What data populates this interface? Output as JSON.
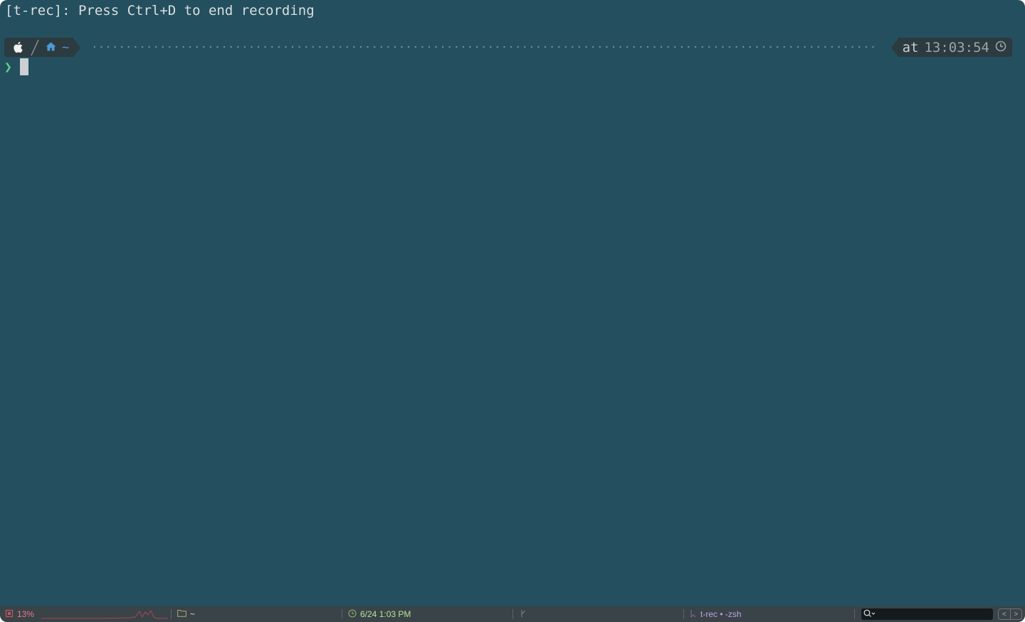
{
  "terminal": {
    "banner": "[t-rec]: Press Ctrl+D to end recording",
    "prompt": {
      "os_icon": "apple-icon",
      "dir_icon": "home-icon",
      "dir": "~",
      "at_label": "at",
      "time": "13:03:54",
      "time_icon": "clock-icon",
      "prompt_char": "❯"
    }
  },
  "statusbar": {
    "cpu": {
      "icon": "cpu-icon",
      "value": "13%"
    },
    "directory": {
      "icon": "folder-icon",
      "value": "~"
    },
    "datetime": {
      "icon": "clock-icon",
      "value": "6/24 1:03 PM"
    },
    "git": {
      "icon": "git-branch-icon"
    },
    "job": {
      "icon": "process-icon",
      "value": "t-rec • -zsh"
    },
    "search": {
      "icon": "search-icon",
      "placeholder": ""
    },
    "nav": {
      "back": "<",
      "forward": ">"
    }
  },
  "colors": {
    "background": "#244f5f",
    "segment": "#2c3b40",
    "prompt_char": "#5fd38d",
    "dir": "#4c9bd6",
    "cpu": "#e67a84",
    "date": "#b6e39a",
    "job": "#b9a3e3"
  }
}
